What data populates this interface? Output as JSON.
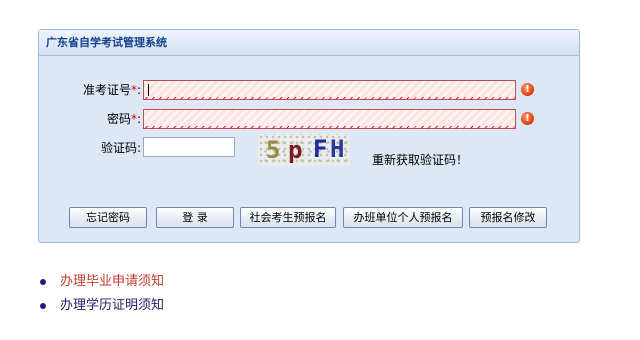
{
  "panel": {
    "title": "广东省自学考试管理系统"
  },
  "form": {
    "exam_id_label": "准考证号",
    "password_label": "密码",
    "captcha_label": "验证码",
    "required_mark": "*",
    "colon": ":",
    "captcha_text": "5pFH",
    "refresh_captcha_label": "重新获取验证码！",
    "error_icon": "exclamation-icon"
  },
  "buttons": {
    "forgot_password": "忘记密码",
    "login": "登 录",
    "public_prereg": "社会考生预报名",
    "class_unit_prereg": "办班单位个人预报名",
    "prereg_modify": "预报名修改"
  },
  "links": [
    {
      "text": "办理毕业申请须知",
      "color": "#c0392b"
    },
    {
      "text": "办理学历证明须知",
      "color": "#20206a"
    }
  ],
  "colors": {
    "panel_bg": "#dde7f6",
    "panel_border": "#9cb8dc",
    "header_text": "#15428b",
    "required": "#d80000",
    "error_border": "#c0504d"
  }
}
